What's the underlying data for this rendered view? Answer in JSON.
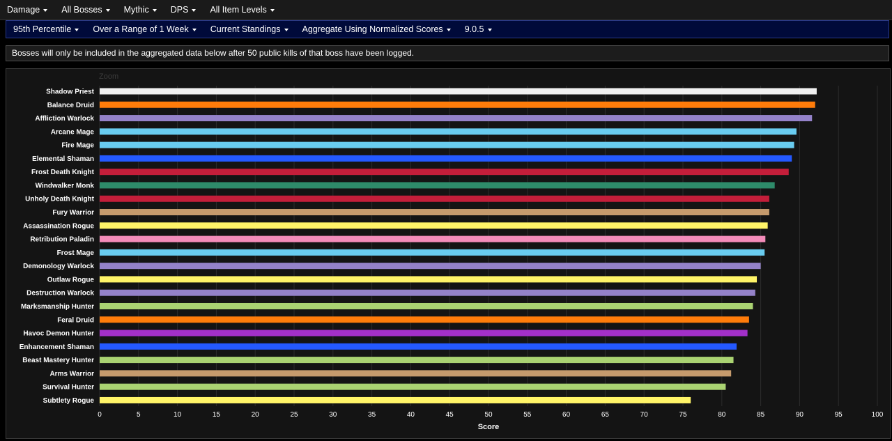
{
  "top_menu": [
    {
      "label": "Damage"
    },
    {
      "label": "All Bosses"
    },
    {
      "label": "Mythic"
    },
    {
      "label": "DPS"
    },
    {
      "label": "All Item Levels"
    }
  ],
  "filter_menu": [
    {
      "label": "95th Percentile"
    },
    {
      "label": "Over a Range of 1 Week"
    },
    {
      "label": "Current Standings"
    },
    {
      "label": "Aggregate Using Normalized Scores"
    },
    {
      "label": "9.0.5"
    }
  ],
  "notice": "Bosses will only be included in the aggregated data below after 50 public kills of that boss have been logged.",
  "chart_data": {
    "type": "bar",
    "orientation": "horizontal",
    "zoom_label": "Zoom",
    "xlabel": "Score",
    "xlim": [
      0,
      100
    ],
    "ticks": [
      0,
      5,
      10,
      15,
      20,
      25,
      30,
      35,
      40,
      45,
      50,
      55,
      60,
      65,
      70,
      75,
      80,
      85,
      90,
      95,
      100
    ],
    "grid": true,
    "categories": [
      "Shadow Priest",
      "Balance Druid",
      "Affliction Warlock",
      "Arcane Mage",
      "Fire Mage",
      "Elemental Shaman",
      "Frost Death Knight",
      "Windwalker Monk",
      "Unholy Death Knight",
      "Fury Warrior",
      "Assassination Rogue",
      "Retribution Paladin",
      "Frost Mage",
      "Demonology Warlock",
      "Outlaw Rogue",
      "Destruction Warlock",
      "Marksmanship Hunter",
      "Feral Druid",
      "Havoc Demon Hunter",
      "Enhancement Shaman",
      "Beast Mastery Hunter",
      "Arms Warrior",
      "Survival Hunter",
      "Subtlety Rogue"
    ],
    "values": [
      92.2,
      92.0,
      91.6,
      89.6,
      89.3,
      89.0,
      88.6,
      86.8,
      86.1,
      86.1,
      85.9,
      85.6,
      85.5,
      85.0,
      84.5,
      84.3,
      84.0,
      83.5,
      83.3,
      81.9,
      81.5,
      81.2,
      80.5,
      76.0
    ],
    "colors": [
      "#f0f0f0",
      "#ff7c0a",
      "#9482c9",
      "#69ccf0",
      "#69ccf0",
      "#2459ff",
      "#c41e3a",
      "#2e8b6a",
      "#c41e3a",
      "#c69b6d",
      "#fff468",
      "#f48cba",
      "#69ccf0",
      "#9482c9",
      "#fff468",
      "#9482c9",
      "#aad372",
      "#ff7c0a",
      "#a330c9",
      "#2459ff",
      "#aad372",
      "#c69b6d",
      "#aad372",
      "#fff468"
    ]
  }
}
